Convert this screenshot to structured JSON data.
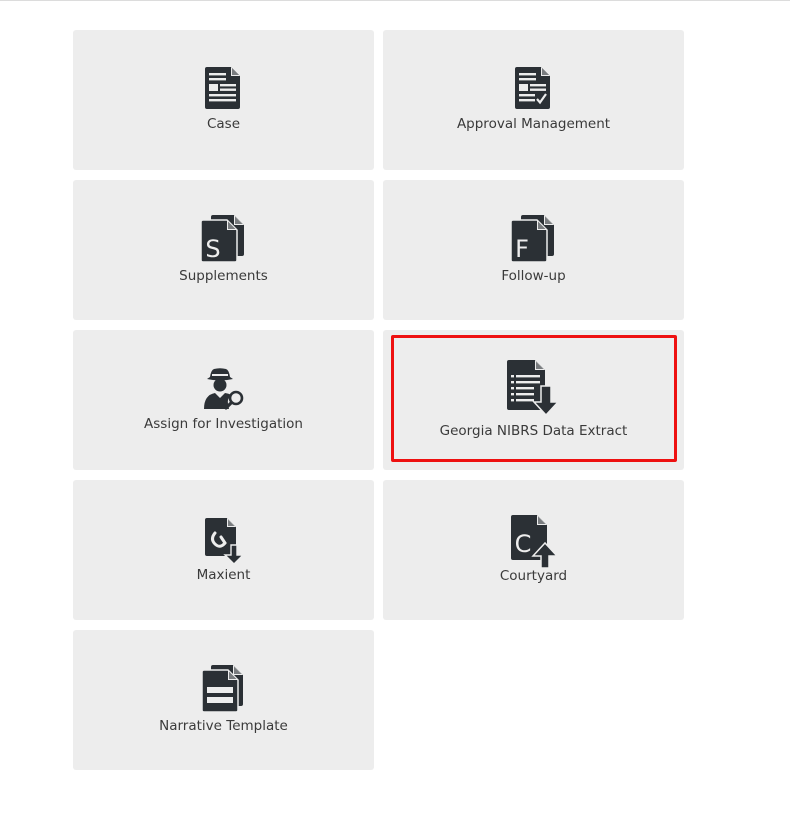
{
  "tiles": {
    "case": {
      "label": "Case",
      "icon": "case-document-icon"
    },
    "approval": {
      "label": "Approval Management",
      "icon": "approval-document-icon"
    },
    "supplements": {
      "label": "Supplements",
      "icon": "supplements-s-icon"
    },
    "followup": {
      "label": "Follow-up",
      "icon": "followup-f-icon"
    },
    "assign": {
      "label": "Assign for Investigation",
      "icon": "investigator-icon"
    },
    "georgia": {
      "label": "Georgia NIBRS Data Extract",
      "icon": "data-extract-icon"
    },
    "maxient": {
      "label": "Maxient",
      "icon": "maxient-icon"
    },
    "courtyard": {
      "label": "Courtyard",
      "icon": "courtyard-c-icon"
    },
    "narrative": {
      "label": "Narrative Template",
      "icon": "narrative-template-icon"
    }
  },
  "selection": {
    "highlighted_tile": "Georgia NIBRS Data Extract",
    "highlight_color": "#ee1111"
  },
  "colors": {
    "tile_bg": "#ededed",
    "icon": "#2b3035",
    "text": "#3a3a3a"
  }
}
